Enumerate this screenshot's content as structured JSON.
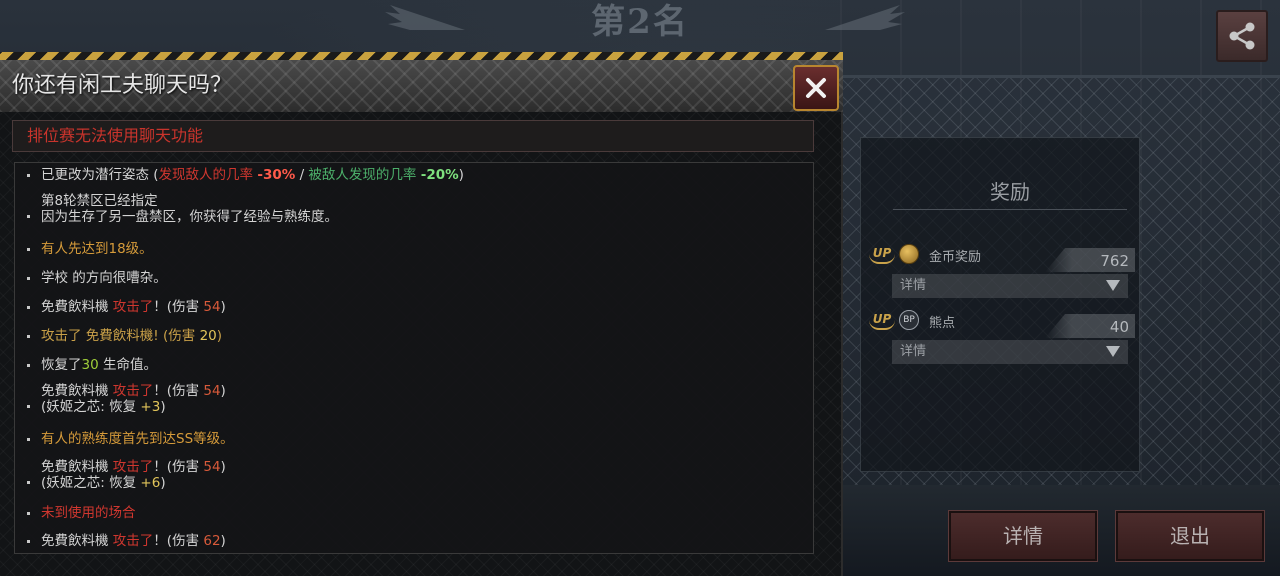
{
  "background": {
    "rank_title": "第2名"
  },
  "rewards": {
    "title": "奖励",
    "items": [
      {
        "up_label": "UP",
        "icon": "coin-icon",
        "label": "金币奖励",
        "value": "762",
        "detail_label": "详情"
      },
      {
        "up_label": "UP",
        "icon": "bear-icon",
        "icon_text": "BP",
        "label": "熊点",
        "value": "40",
        "detail_label": "详情"
      }
    ]
  },
  "buttons": {
    "details": "详情",
    "exit": "退出"
  },
  "dialog": {
    "title": "你还有闲工夫聊天吗？",
    "notice": "排位赛无法使用聊天功能",
    "lines": [
      {
        "parts": [
          {
            "t": "已更改为潜行姿态 (",
            "c": "white"
          },
          {
            "t": "发现敌人的几率 ",
            "c": "red"
          },
          {
            "t": "-30%",
            "c": "bright-red"
          },
          {
            "t": " / ",
            "c": "white"
          },
          {
            "t": "被敌人发现的几率 ",
            "c": "green"
          },
          {
            "t": "-20%",
            "c": "bright-green"
          },
          {
            "t": ")",
            "c": "white"
          }
        ]
      },
      {
        "line1": "第8轮禁区已经指定",
        "line2": "因为生存了另一盘禁区，你获得了经验与熟练度。"
      },
      {
        "parts": [
          {
            "t": "有人先达到18级。",
            "c": "orange"
          }
        ]
      },
      {
        "parts": [
          {
            "t": "学校 的方向很嘈杂。",
            "c": "white"
          }
        ]
      },
      {
        "parts": [
          {
            "t": "免費飲料機  ",
            "c": "white"
          },
          {
            "t": "攻击了",
            "c": "red"
          },
          {
            "t": "！(伤害 ",
            "c": "white"
          },
          {
            "t": "54",
            "c": "val-red"
          },
          {
            "t": ")",
            "c": "white"
          }
        ]
      },
      {
        "parts": [
          {
            "t": "攻击了 免費飲料機! (伤害 ",
            "c": "gold"
          },
          {
            "t": "20",
            "c": "yellow"
          },
          {
            "t": ")",
            "c": "gold"
          }
        ]
      },
      {
        "parts": [
          {
            "t": "恢复了",
            "c": "white"
          },
          {
            "t": "30",
            "c": "lime"
          },
          {
            "t": " 生命值。",
            "c": "white"
          }
        ]
      },
      {
        "two_line": true,
        "parts": [
          {
            "t": "免費飲料機  ",
            "c": "white"
          },
          {
            "t": "攻击了",
            "c": "red"
          },
          {
            "t": "！(伤害 ",
            "c": "white"
          },
          {
            "t": "54",
            "c": "val-red"
          },
          {
            "t": ")",
            "c": "white"
          }
        ],
        "parts2": [
          {
            "t": "(妖姬之芯: 恢复 ",
            "c": "white"
          },
          {
            "t": "+3",
            "c": "yellow"
          },
          {
            "t": ")",
            "c": "white"
          }
        ]
      },
      {
        "parts": [
          {
            "t": "有人的熟练度首先到达SS等级。",
            "c": "orange"
          }
        ]
      },
      {
        "two_line": true,
        "parts": [
          {
            "t": "免費飲料機  ",
            "c": "white"
          },
          {
            "t": "攻击了",
            "c": "red"
          },
          {
            "t": "！(伤害 ",
            "c": "white"
          },
          {
            "t": "54",
            "c": "val-red"
          },
          {
            "t": ")",
            "c": "white"
          }
        ],
        "parts2": [
          {
            "t": "(妖姬之芯: 恢复 ",
            "c": "white"
          },
          {
            "t": "+6",
            "c": "yellow"
          },
          {
            "t": ")",
            "c": "white"
          }
        ]
      },
      {
        "parts": [
          {
            "t": "未到使用的场合",
            "c": "red"
          }
        ]
      },
      {
        "parts": [
          {
            "t": "免費飲料機  ",
            "c": "white"
          },
          {
            "t": "攻击了",
            "c": "red"
          },
          {
            "t": "！(伤害 ",
            "c": "white"
          },
          {
            "t": "62",
            "c": "val-red"
          },
          {
            "t": ")",
            "c": "white"
          }
        ]
      }
    ]
  }
}
